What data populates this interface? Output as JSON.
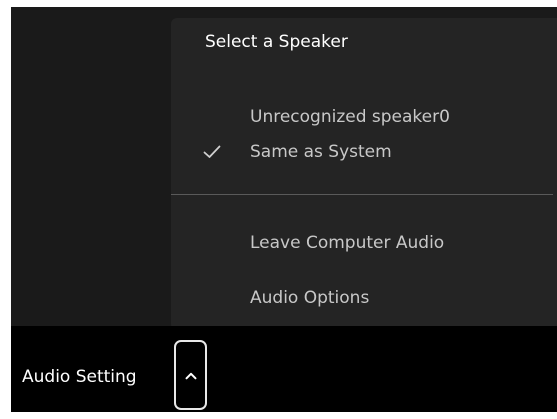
{
  "speaker_menu": {
    "heading": "Select a Speaker",
    "speakers": [
      {
        "label": "Unrecognized speaker0",
        "selected": false
      },
      {
        "label": "Same as System",
        "selected": true
      }
    ],
    "actions": [
      {
        "label": "Leave Computer Audio"
      },
      {
        "label": "Audio Options"
      }
    ]
  },
  "toolbar": {
    "audio_setting_label": "Audio Setting",
    "caret_icon": "chevron-up-icon",
    "check_icon": "checkmark-icon"
  },
  "colors": {
    "menu_background": "#242424",
    "toolbar_background": "#000000",
    "text_primary": "#ffffff",
    "text_secondary": "#c8c8c8"
  }
}
